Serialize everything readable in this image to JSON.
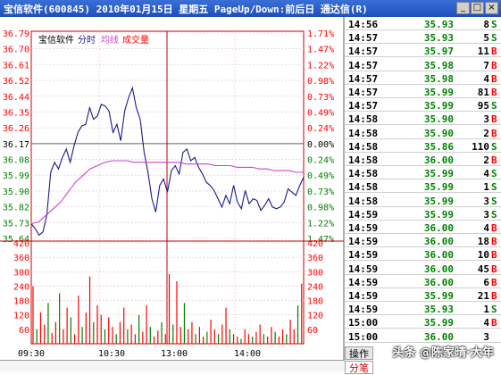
{
  "window": {
    "title": "宝信软件(600845)  2010年01月15日  星期五  PageUp/Down:前后日  通达信(R)",
    "buttons": [
      "_",
      "□",
      "×"
    ]
  },
  "chart": {
    "stock_name": "宝信软件",
    "legend_minute": "分时",
    "legend_avg": "均线",
    "legend_volume": "成交量",
    "colors": {
      "price_line": "#1a1a8c",
      "avg_line": "#d040d0",
      "up": "#ff0000",
      "down": "#008000",
      "neutral": "#000000",
      "volume_up": "#ff0000",
      "volume_down": "#008000"
    }
  },
  "chart_data": {
    "type": "line",
    "title": "宝信软件",
    "price_axis_left": [
      "36.79",
      "36.70",
      "36.61",
      "36.52",
      "36.44",
      "36.35",
      "36.26",
      "36.17",
      "36.08",
      "35.99",
      "35.90",
      "35.82",
      "35.73",
      "35.64"
    ],
    "pct_axis_right": [
      "1.71%",
      "1.47%",
      "1.22%",
      "0.98%",
      "0.73%",
      "0.49%",
      "0.24%",
      "0.00%",
      "0.24%",
      "0.49%",
      "0.73%",
      "0.98%",
      "1.22%",
      "1.47%"
    ],
    "ylim": [
      35.55,
      36.79
    ],
    "prev_close": 36.17,
    "volume_axis": [
      "420",
      "360",
      "300",
      "240",
      "180",
      "120",
      "60"
    ],
    "volume_ylim": [
      0,
      420
    ],
    "x_ticks": [
      "09:30",
      "10:30",
      "13:00",
      "14:00"
    ],
    "series": [
      {
        "name": "分时",
        "values": [
          35.65,
          35.62,
          35.58,
          35.6,
          35.7,
          35.96,
          36.02,
          35.98,
          36.05,
          36.1,
          36.02,
          36.12,
          36.2,
          36.24,
          36.25,
          36.35,
          36.28,
          36.3,
          36.37,
          36.36,
          36.33,
          36.2,
          36.25,
          36.15,
          36.33,
          36.41,
          36.47,
          36.35,
          36.28,
          36.08,
          35.96,
          35.8,
          35.72,
          35.88,
          35.92,
          35.84,
          35.97,
          36.0,
          35.95,
          36.08,
          36.1,
          36.03,
          36.05,
          35.99,
          35.95,
          35.9,
          35.88,
          35.85,
          35.8,
          35.75,
          35.82,
          35.77,
          35.88,
          35.78,
          35.74,
          35.85,
          35.77,
          35.8,
          35.79,
          35.73,
          35.76,
          35.8,
          35.75,
          35.74,
          35.75,
          35.78,
          35.86,
          35.84,
          35.82,
          35.88,
          35.93
        ]
      },
      {
        "name": "均线",
        "values": [
          35.65,
          35.66,
          35.7,
          35.74,
          35.78,
          35.84,
          35.9,
          35.94,
          35.98,
          36.0,
          36.02,
          36.03,
          36.03,
          36.03,
          36.02,
          36.02,
          36.02,
          36.02,
          36.02,
          36.02,
          36.02,
          36.01,
          36.01,
          36.01,
          36.01,
          36.0,
          36.0,
          36.0,
          35.99,
          35.99,
          35.99,
          35.98,
          35.98,
          35.97,
          35.97,
          35.97,
          35.96,
          35.96
        ]
      }
    ],
    "volumes": [
      240,
      60,
      130,
      80,
      170,
      45,
      90,
      210,
      60,
      150,
      110,
      40,
      200,
      70,
      130,
      280,
      90,
      160,
      120,
      60,
      110,
      70,
      40,
      90,
      150,
      60,
      80,
      40,
      120,
      50,
      160,
      70,
      30,
      55,
      90,
      40,
      290,
      80,
      260,
      70,
      170,
      60,
      90,
      40,
      70,
      30,
      50,
      100,
      60,
      40,
      80,
      150,
      60,
      40,
      30,
      20,
      60,
      40,
      30,
      50,
      80,
      40,
      30,
      70,
      50,
      30,
      60,
      40,
      100,
      60,
      160,
      250
    ]
  },
  "ticks": [
    {
      "time": "14:56",
      "price": "35.93",
      "volume": "8",
      "side": "S"
    },
    {
      "time": "14:57",
      "price": "35.93",
      "volume": "5",
      "side": "S"
    },
    {
      "time": "14:57",
      "price": "35.97",
      "volume": "11",
      "side": "B"
    },
    {
      "time": "14:57",
      "price": "35.98",
      "volume": "7",
      "side": "B"
    },
    {
      "time": "14:57",
      "price": "35.98",
      "volume": "4",
      "side": "B"
    },
    {
      "time": "14:57",
      "price": "35.99",
      "volume": "81",
      "side": "B"
    },
    {
      "time": "14:57",
      "price": "35.99",
      "volume": "95",
      "side": "S"
    },
    {
      "time": "14:58",
      "price": "35.90",
      "volume": "3",
      "side": "B"
    },
    {
      "time": "14:58",
      "price": "35.90",
      "volume": "2",
      "side": "B"
    },
    {
      "time": "14:58",
      "price": "35.86",
      "volume": "110",
      "side": "S"
    },
    {
      "time": "14:58",
      "price": "36.00",
      "volume": "2",
      "side": "B"
    },
    {
      "time": "14:58",
      "price": "35.99",
      "volume": "4",
      "side": "S"
    },
    {
      "time": "14:58",
      "price": "35.99",
      "volume": "1",
      "side": "S"
    },
    {
      "time": "14:58",
      "price": "35.99",
      "volume": "3",
      "side": "S"
    },
    {
      "time": "14:59",
      "price": "35.99",
      "volume": "3",
      "side": "S"
    },
    {
      "time": "14:59",
      "price": "36.00",
      "volume": "4",
      "side": "B"
    },
    {
      "time": "14:59",
      "price": "36.00",
      "volume": "18",
      "side": "B"
    },
    {
      "time": "14:59",
      "price": "36.00",
      "volume": "10",
      "side": "B"
    },
    {
      "time": "14:59",
      "price": "36.00",
      "volume": "45",
      "side": "B"
    },
    {
      "time": "14:59",
      "price": "36.00",
      "volume": "6",
      "side": "B"
    },
    {
      "time": "14:59",
      "price": "35.99",
      "volume": "21",
      "side": "B"
    },
    {
      "time": "14:59",
      "price": "35.93",
      "volume": "1",
      "side": "S"
    },
    {
      "time": "15:00",
      "price": "35.99",
      "volume": "4",
      "side": "B"
    },
    {
      "time": "15:00",
      "price": "36.00",
      "volume": "3",
      "side": ""
    }
  ],
  "tabs": {
    "ops": "操作",
    "ticks": "分笔"
  },
  "watermark": "头条 @陈家晴·大年"
}
